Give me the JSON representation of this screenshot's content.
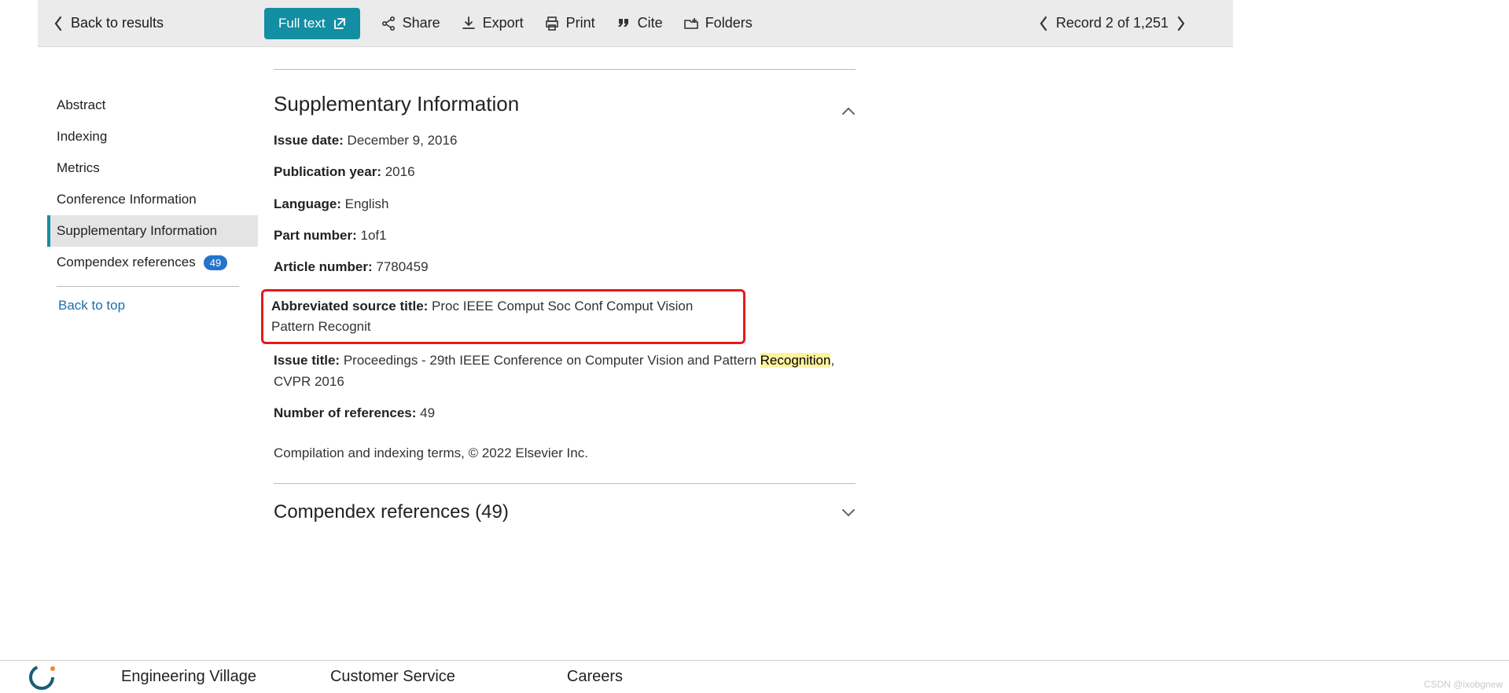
{
  "topbar": {
    "back": "Back to results",
    "full_text": "Full text",
    "share": "Share",
    "export": "Export",
    "print": "Print",
    "cite": "Cite",
    "folders": "Folders",
    "record_prefix": "Record ",
    "record_num": "2",
    "record_of": " of ",
    "record_total": "1,251"
  },
  "sidebar": {
    "abstract": "Abstract",
    "indexing": "Indexing",
    "metrics": "Metrics",
    "conf_info": "Conference Information",
    "supp_info": "Supplementary Information",
    "comp_refs": "Compendex references",
    "comp_refs_count": "49",
    "back_top": "Back to top"
  },
  "supp": {
    "heading": "Supplementary Information",
    "issue_date_label": "Issue date:",
    "issue_date": " December 9, 2016",
    "pub_year_label": "Publication year:",
    "pub_year": " 2016",
    "lang_label": "Language:",
    "lang": " English",
    "part_label": "Part number:",
    "part": " 1of1",
    "article_label": "Article number:",
    "article": " 7780459",
    "abbr_label": "Abbreviated source title:",
    "abbr": "  Proc IEEE Comput Soc Conf Comput Vision Pattern Recognit",
    "issue_title_label": "Issue title:",
    "issue_title_pre": "  Proceedings - 29th IEEE Conference on Computer Vision and Pattern ",
    "issue_title_mark": "Recognition",
    "issue_title_post": ", CVPR 2016",
    "num_refs_label": "Number of references:",
    "num_refs": " 49",
    "copyright": "Compilation and indexing terms, © 2022 Elsevier Inc."
  },
  "refs": {
    "heading": "Compendex references (49)"
  },
  "footer": {
    "col1": "Engineering Village",
    "col2": "Customer Service",
    "col3": "Careers"
  },
  "watermark": "CSDN @ixobgnew"
}
